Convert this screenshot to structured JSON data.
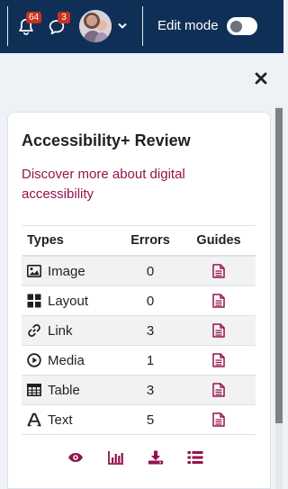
{
  "navbar": {
    "notifications": {
      "icon": "bell-icon",
      "count": "64"
    },
    "messages": {
      "icon": "chat-icon",
      "count": "3"
    },
    "user_menu": {
      "icon": "chevron-down-icon"
    },
    "edit_mode_label": "Edit mode",
    "edit_mode_on": false
  },
  "drawer": {
    "close_icon": "close-icon"
  },
  "review": {
    "title": "Accessibility+ Review",
    "link_text": "Discover more about digital accessibility",
    "columns": {
      "types": "Types",
      "errors": "Errors",
      "guides": "Guides"
    },
    "rows": [
      {
        "type": "Image",
        "errors": "0",
        "icon": "image-icon"
      },
      {
        "type": "Layout",
        "errors": "0",
        "icon": "layout-icon"
      },
      {
        "type": "Link",
        "errors": "3",
        "icon": "link-icon"
      },
      {
        "type": "Media",
        "errors": "1",
        "icon": "play-icon"
      },
      {
        "type": "Table",
        "errors": "3",
        "icon": "table-icon"
      },
      {
        "type": "Text",
        "errors": "5",
        "icon": "text-icon"
      }
    ],
    "actions": [
      "eye-icon",
      "bar-chart-icon",
      "download-icon",
      "list-icon"
    ]
  },
  "colors": {
    "navbar": "#0f2f57",
    "accent": "#94124e",
    "badge": "#ca3120"
  }
}
